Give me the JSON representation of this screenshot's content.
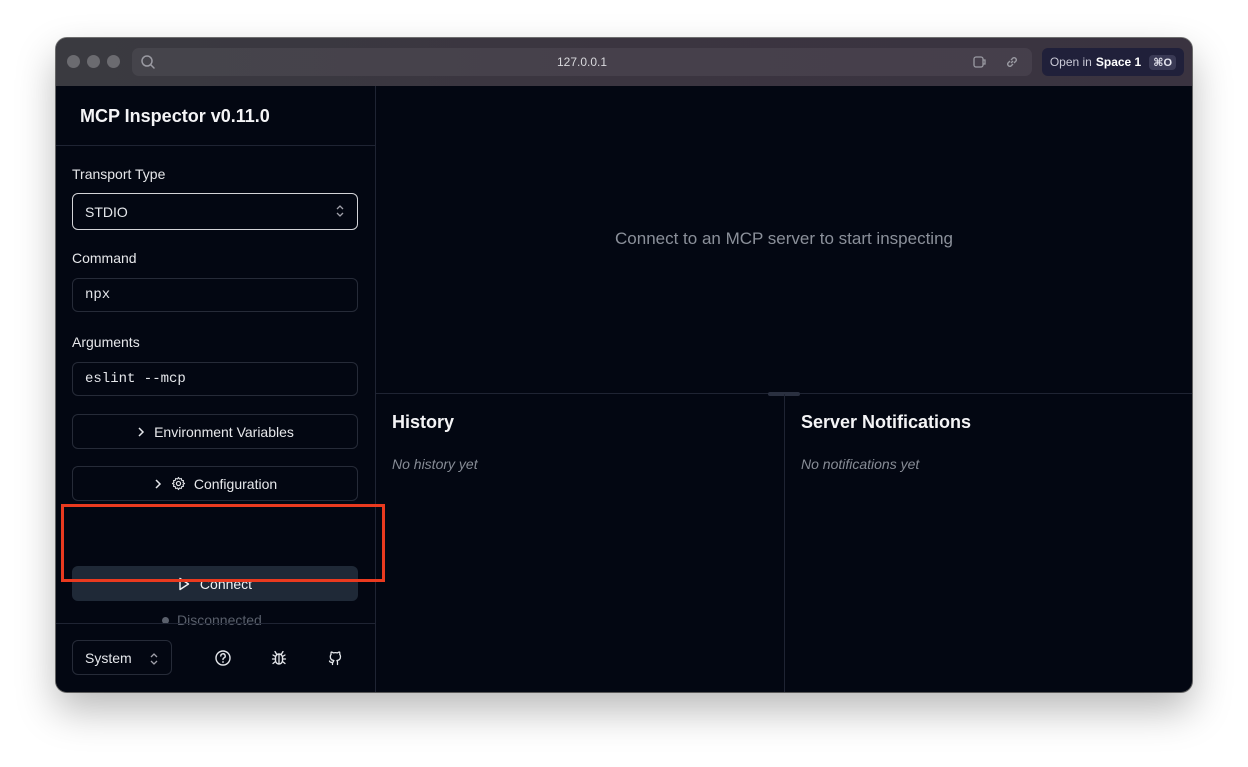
{
  "browser": {
    "url": "127.0.0.1",
    "open_in_prefix": "Open in",
    "open_in_target": "Space 1",
    "shortcut": "⌘O"
  },
  "sidebar": {
    "app_title": "MCP Inspector v0.11.0",
    "transport_label": "Transport Type",
    "transport_value": "STDIO",
    "command_label": "Command",
    "command_value": "npx",
    "arguments_label": "Arguments",
    "arguments_value": "eslint --mcp",
    "env_vars_label": "Environment Variables",
    "configuration_label": "Configuration",
    "connect_label": "Connect",
    "status_text": "Disconnected",
    "theme_value": "System"
  },
  "main": {
    "empty_message": "Connect to an MCP server to start inspecting",
    "history_title": "History",
    "history_empty": "No history yet",
    "notifications_title": "Server Notifications",
    "notifications_empty": "No notifications yet"
  },
  "colors": {
    "background": "#030712",
    "highlight_box": "#ea3a1f",
    "connect_button": "#1f2937"
  }
}
